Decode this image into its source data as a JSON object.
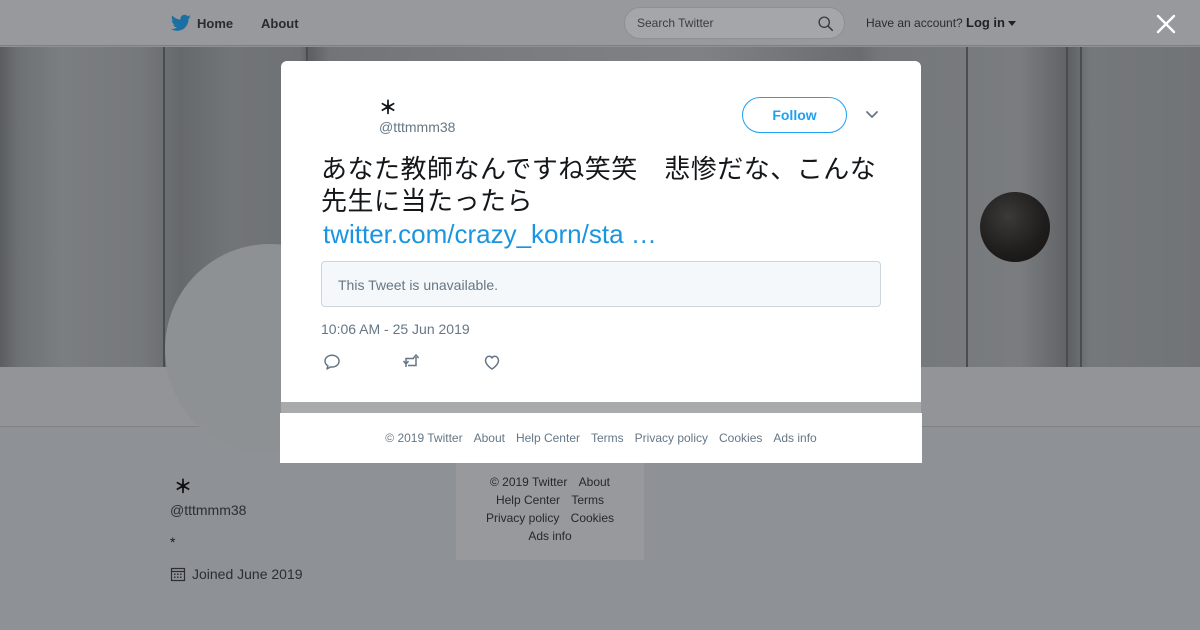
{
  "topbar": {
    "home_label": "Home",
    "about_label": "About",
    "search_placeholder": "Search Twitter",
    "account_prompt": "Have an account?",
    "login_label": "Log in"
  },
  "profile": {
    "name": "＊",
    "handle": "@tttmmm38",
    "bio": "*",
    "joined": "Joined June 2019"
  },
  "side_footer": {
    "row1": [
      "© 2019 Twitter",
      "About"
    ],
    "row2": [
      "Help Center",
      "Terms"
    ],
    "row3": [
      "Privacy policy",
      "Cookies"
    ],
    "row4": [
      "Ads info"
    ]
  },
  "tweet": {
    "author_name": "＊",
    "author_handle": "@tttmmm38",
    "follow_label": "Follow",
    "text": "あなた教師なんですね笑笑　悲惨だな、こんな先生に当たったら",
    "link_text": "twitter.com/crazy_korn/sta …",
    "quoted_unavailable": "This Tweet is unavailable.",
    "timestamp": "10:06 AM - 25 Jun 2019"
  },
  "modal_footer": {
    "items": [
      "© 2019 Twitter",
      "About",
      "Help Center",
      "Terms",
      "Privacy policy",
      "Cookies",
      "Ads info"
    ]
  },
  "colors": {
    "accent": "#1da1f2",
    "link": "#1b95e0",
    "muted": "#657786"
  },
  "icons": {
    "brand": "twitter-bird-icon",
    "search": "search-icon",
    "close": "close-icon",
    "calendar": "calendar-icon",
    "menu": "chevron-down-icon",
    "reply": "reply-icon",
    "retweet": "retweet-icon",
    "like": "heart-icon"
  }
}
